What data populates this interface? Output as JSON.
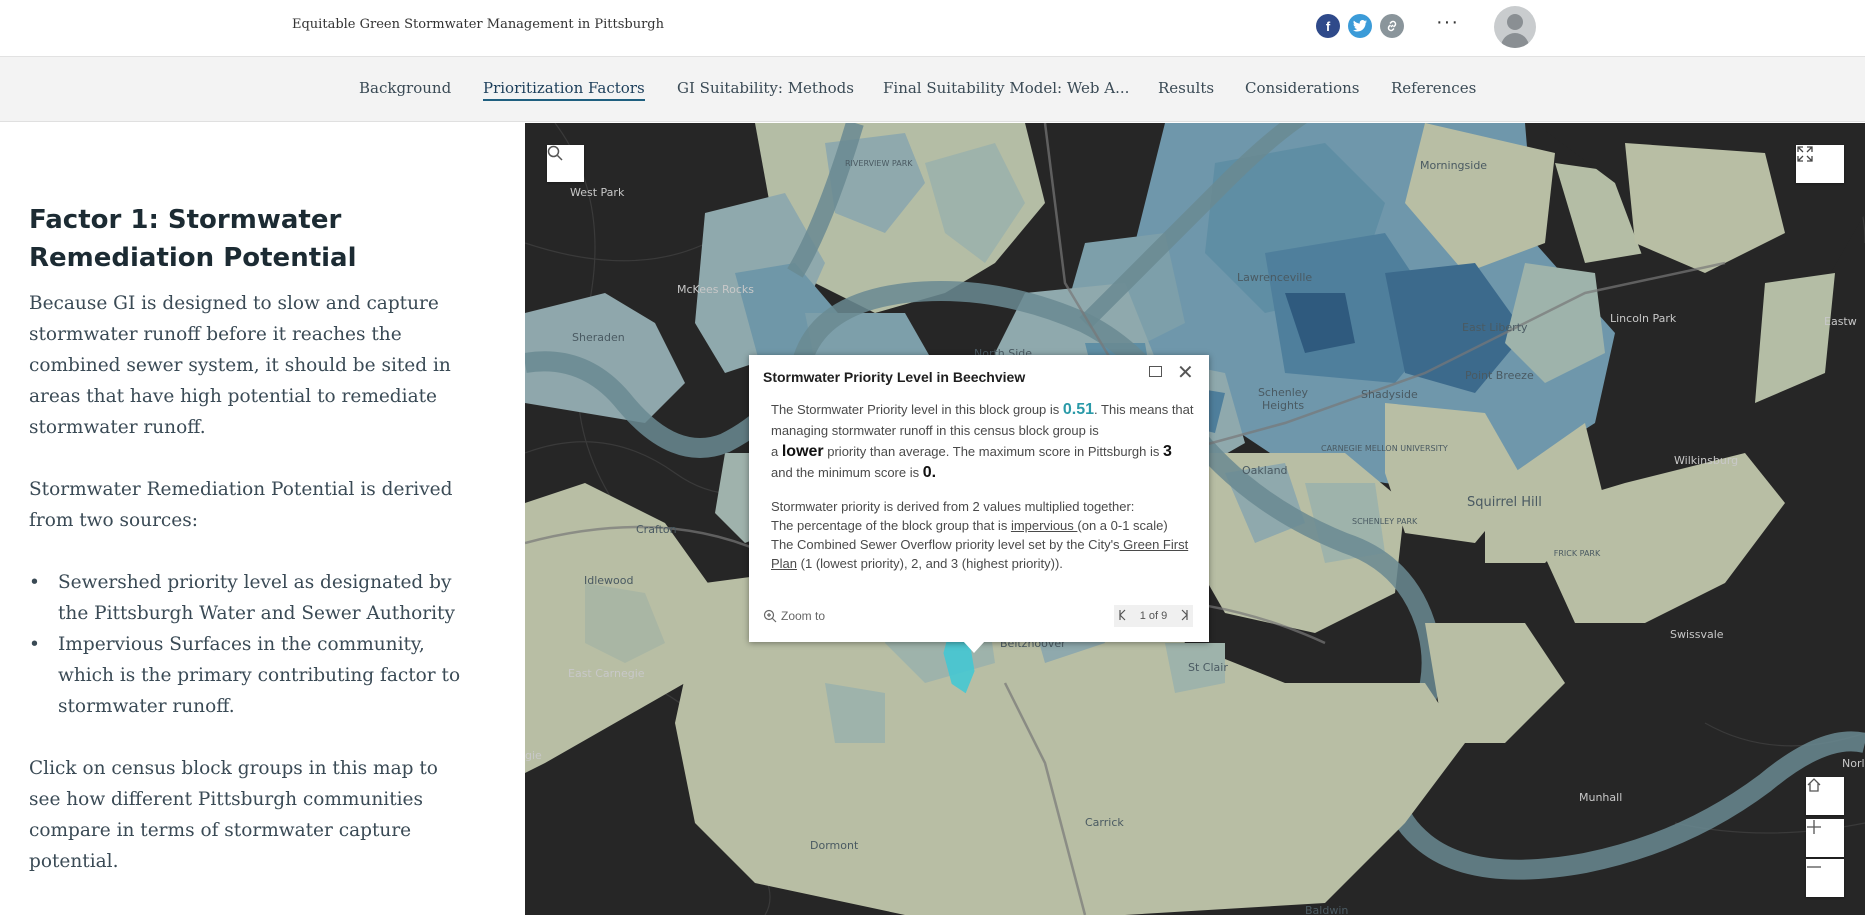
{
  "header": {
    "title": "Equitable Green Stormwater Management in Pittsburgh",
    "share_icons": [
      "facebook-icon",
      "twitter-icon",
      "link-icon"
    ],
    "more_label": "···"
  },
  "nav": {
    "items": [
      {
        "label": "Background"
      },
      {
        "label": "Prioritization Factors"
      },
      {
        "label": "GI Suitability: Methods"
      },
      {
        "label": "Final Suitability Model: Web A..."
      },
      {
        "label": "Results"
      },
      {
        "label": "Considerations"
      },
      {
        "label": "References"
      }
    ],
    "active_index": 1
  },
  "narrative": {
    "heading": "Factor 1: Stormwater Remediation Potential",
    "para1": "Because GI is designed to slow and capture stormwater runoff before it reaches the combined sewer system, it should be sited in areas that have high potential to remediate stormwater runoff.",
    "para2": "Stormwater Remediation Potential is derived from two sources:",
    "bullets": [
      "Sewershed priority level as designated by the Pittsburgh Water and Sewer Authority",
      "Impervious Surfaces in the community, which is the primary contributing factor to stormwater runoff."
    ],
    "para3": "Click on census block groups in this map to see how different Pittsburgh communities compare in terms of stormwater capture potential."
  },
  "map": {
    "labels": {
      "west_park": "West Park",
      "mckees_rocks": "McKees Rocks",
      "sheraden": "Sheraden",
      "crafton": "Crafton",
      "idlewood": "Idlewood",
      "east_carnegie": "East Carnegie",
      "gie": "gie",
      "dormont": "Dormont",
      "carrick": "Carrick",
      "st_clair": "St Clair",
      "lawrenceville": "Lawrenceville",
      "morningside": "Morningside",
      "east_liberty": "East Liberty",
      "lincoln_park": "Lincoln Park",
      "eastw": "Eastw",
      "point_breeze": "Point Breeze",
      "shadyside": "Shadyside",
      "schenley_heights": "Schenley Heights",
      "oakland": "Oakland",
      "wilkinsburg": "Wilkinsburg",
      "squirrel_hill": "Squirrel Hill",
      "swissvale": "Swissvale",
      "munhall": "Munhall",
      "baldwin": "Baldwin",
      "norl": "Norl",
      "riverview_park": "RIVERVIEW PARK",
      "carnegie_mellon": "CARNEGIE MELLON UNIVERSITY",
      "schenley_park": "SCHENLEY PARK",
      "frick_park": "FRICK PARK",
      "beltzhoover": "Beltzhoover",
      "north_side": "North Side"
    },
    "colors": {
      "background": "#262626",
      "low": "#b8bea4",
      "mid": "#8fa9ad",
      "high": "#5f8ea4",
      "highest": "#2f5a7e",
      "selected": "#3fc9d6"
    }
  },
  "popup": {
    "title": "Stormwater Priority Level in Beechview",
    "line1_pre": "The Stormwater Priority level in this block group is ",
    "value": "0.51",
    "line1_post": ". This means that managing stormwater runoff in this census block group is",
    "line2_pre": "a ",
    "level_word": "lower",
    "line2_mid": " priority than average. The maximum score in Pittsburgh is ",
    "max_score": "3",
    "line3_pre": "and the minimum score is ",
    "min_score": "0.",
    "sec2_line1": "Stormwater priority is derived from 2 values multiplied together:",
    "sec2_line2_pre": "The percentage of the block group that is ",
    "sec2_link1": "impervious ",
    "sec2_line2_post": " (on a 0-1 scale)",
    "sec2_line3_pre": "The Combined Sewer Overflow priority level set by the City's",
    "sec2_link2": " Green First Plan",
    "sec2_line3_post": " (1 (lowest priority), 2, and 3 (highest priority)).",
    "zoom_label": "Zoom to",
    "pager_label": "1 of 9"
  }
}
